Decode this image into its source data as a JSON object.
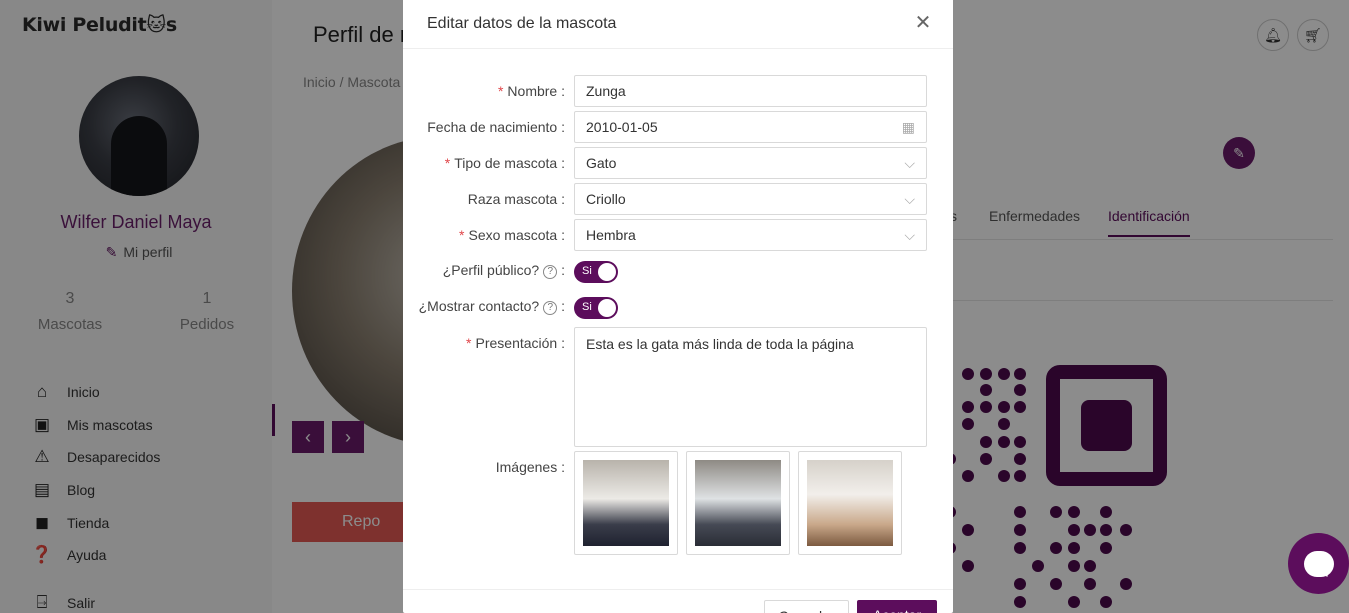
{
  "app": {
    "logo": "Kiwi Peludit🐱s"
  },
  "sidebar": {
    "user_name": "Wilfer Daniel Maya",
    "profile_link": "Mi perfil",
    "stats": [
      {
        "value": "3",
        "label": "Mascotas"
      },
      {
        "value": "1",
        "label": "Pedidos"
      }
    ],
    "nav": [
      {
        "label": "Inicio",
        "icon": "home-icon"
      },
      {
        "label": "Mis mascotas",
        "icon": "id-card-icon"
      },
      {
        "label": "Desaparecidos",
        "icon": "alarm-icon"
      },
      {
        "label": "Blog",
        "icon": "document-icon"
      },
      {
        "label": "Tienda",
        "icon": "shopping-bag-icon"
      },
      {
        "label": "Ayuda",
        "icon": "help-icon"
      }
    ],
    "logout": "Salir"
  },
  "page": {
    "title": "Perfil de m",
    "breadcrumb": "Inicio  /  Mascota",
    "report_button": "Repo",
    "tabs": [
      {
        "label": "s",
        "active": false
      },
      {
        "label": "Enfermedades",
        "active": false
      },
      {
        "label": "Identificación",
        "active": true
      }
    ]
  },
  "modal": {
    "title": "Editar datos de la mascota",
    "fields": {
      "name": {
        "label": "Nombre :",
        "value": "Zunga",
        "required": true
      },
      "birth_date": {
        "label": "Fecha de nacimiento :",
        "value": "2010-01-05",
        "required": false
      },
      "pet_type": {
        "label": "Tipo de mascota :",
        "value": "Gato",
        "required": true
      },
      "breed": {
        "label": "Raza mascota :",
        "value": "Criollo",
        "required": false
      },
      "sex": {
        "label": "Sexo mascota :",
        "value": "Hembra",
        "required": true
      },
      "public_profile": {
        "label": "¿Perfil público?",
        "value": "Si",
        "on": true
      },
      "show_contact": {
        "label": "¿Mostrar contacto?",
        "value": "Si",
        "on": true
      },
      "presentation": {
        "label": "Presentación :",
        "value": "Esta es la gata más linda de toda la página",
        "required": true
      },
      "images": {
        "label": "Imágenes :",
        "count": 3
      }
    },
    "footer": {
      "cancel": "Cancelar",
      "accept": "Aceptar"
    }
  },
  "colors": {
    "brand": "#5c0d5c",
    "danger": "#e55a55",
    "required": "#e0464a"
  }
}
